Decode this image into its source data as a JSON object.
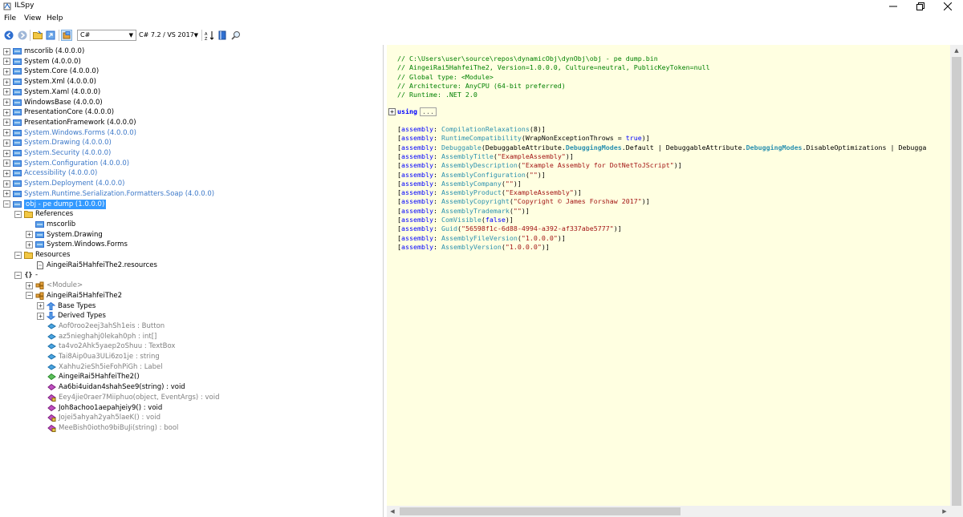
{
  "window": {
    "title": "ILSpy"
  },
  "menu": [
    "File",
    "View",
    "Help"
  ],
  "toolbar": {
    "language": "C#",
    "version": "C# 7.2 / VS 2017"
  },
  "tree": [
    {
      "label": "mscorlib (4.0.0.0)",
      "style": "normal"
    },
    {
      "label": "System (4.0.0.0)",
      "style": "normal"
    },
    {
      "label": "System.Core (4.0.0.0)",
      "style": "normal"
    },
    {
      "label": "System.Xml (4.0.0.0)",
      "style": "normal"
    },
    {
      "label": "System.Xaml (4.0.0.0)",
      "style": "normal"
    },
    {
      "label": "WindowsBase (4.0.0.0)",
      "style": "normal"
    },
    {
      "label": "PresentationCore (4.0.0.0)",
      "style": "normal"
    },
    {
      "label": "PresentationFramework (4.0.0.0)",
      "style": "normal"
    },
    {
      "label": "System.Windows.Forms (4.0.0.0)",
      "style": "blue"
    },
    {
      "label": "System.Drawing (4.0.0.0)",
      "style": "blue"
    },
    {
      "label": "System.Security (4.0.0.0)",
      "style": "blue"
    },
    {
      "label": "System.Configuration (4.0.0.0)",
      "style": "blue"
    },
    {
      "label": "Accessibility (4.0.0.0)",
      "style": "blue"
    },
    {
      "label": "System.Deployment (4.0.0.0)",
      "style": "blue"
    },
    {
      "label": "System.Runtime.Serialization.Formatters.Soap (4.0.0.0)",
      "style": "blue"
    },
    {
      "label": "obj - pe dump (1.0.0.0)",
      "style": "selected"
    },
    {
      "label": "References",
      "style": "normal"
    },
    {
      "label": "mscorlib",
      "style": "normal"
    },
    {
      "label": "System.Drawing",
      "style": "normal"
    },
    {
      "label": "System.Windows.Forms",
      "style": "normal"
    },
    {
      "label": "Resources",
      "style": "normal"
    },
    {
      "label": "AingeiRai5HahfeiThe2.resources",
      "style": "normal"
    },
    {
      "label": "-",
      "style": "normal"
    },
    {
      "label": "<Module>",
      "style": "gray"
    },
    {
      "label": "AingeiRai5HahfeiThe2",
      "style": "normal"
    },
    {
      "label": "Base Types",
      "style": "normal"
    },
    {
      "label": "Derived Types",
      "style": "normal"
    },
    {
      "label": "Aof0roo2eej3ahSh1eis : Button",
      "style": "gray"
    },
    {
      "label": "az5nieghahj0lekah0ph : int[]",
      "style": "gray"
    },
    {
      "label": "ta4vo2Ahk5yaep2oShuu : TextBox",
      "style": "gray"
    },
    {
      "label": "Tai8Aip0ua3ULi6zo1je : string",
      "style": "gray"
    },
    {
      "label": "Xahhu2ieSh5ieFohPiGh : Label",
      "style": "gray"
    },
    {
      "label": "AingeiRai5HahfeiThe2()",
      "style": "normal"
    },
    {
      "label": "Aa6bi4uidan4shahSee9(string) : void",
      "style": "normal"
    },
    {
      "label": "Eey4jie0raer7Miiphuo(object, EventArgs) : void",
      "style": "gray"
    },
    {
      "label": "Joh8achoo1aepahjeiy9() : void",
      "style": "normal"
    },
    {
      "label": "Jojei5ahyah2yah5laeK() : void",
      "style": "gray"
    },
    {
      "label": "MeeBish0iotho9biBuJi(string) : bool",
      "style": "gray"
    }
  ],
  "code": {
    "header_comments": [
      "// C:\\Users\\user\\source\\repos\\dynamicObj\\dynObj\\obj - pe dump.bin",
      "// AingeiRai5HahfeiThe2, Version=1.0.0.0, Culture=neutral, PublicKeyToken=null",
      "// Global type: <Module>",
      "// Architecture: AnyCPU (64-bit preferred)",
      "// Runtime: .NET 2.0"
    ],
    "using_kw": "using",
    "using_ellipsis": "...",
    "assembly_lines": [
      "[assembly: CompilationRelaxations(8)]",
      "[assembly: RuntimeCompatibility(WrapNonExceptionThrows = true)]",
      "[assembly: Debuggable(DebuggableAttribute.DebuggingModes.Default | DebuggableAttribute.DebuggingModes.DisableOptimizations | Debugga",
      "[assembly: AssemblyTitle(\"ExampleAssembly\")]",
      "[assembly: AssemblyDescription(\"Example Assembly for DotNetToJScript\")]",
      "[assembly: AssemblyConfiguration(\"\")]",
      "[assembly: AssemblyCompany(\"\")]",
      "[assembly: AssemblyProduct(\"ExampleAssembly\")]",
      "[assembly: AssemblyCopyright(\"Copyright © James Forshaw 2017\")]",
      "[assembly: AssemblyTrademark(\"\")]",
      "[assembly: ComVisible(false)]",
      "[assembly: Guid(\"56598f1c-6d88-4994-a392-af337abe5777\")]",
      "[assembly: AssemblyFileVersion(\"1.0.0.0\")]",
      "[assembly: AssemblyVersion(\"1.0.0.0\")]"
    ]
  }
}
